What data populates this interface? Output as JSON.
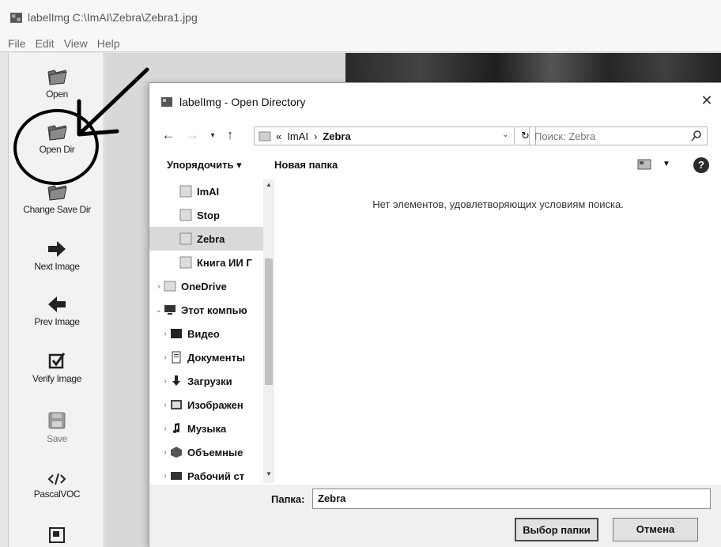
{
  "app": {
    "title": "labelImg C:\\ImAI\\Zebra\\Zebra1.jpg",
    "menu": [
      "File",
      "Edit",
      "View",
      "Help"
    ]
  },
  "toolbar": {
    "items": [
      {
        "label": "Open",
        "icon": "folder-icon"
      },
      {
        "label": "Open Dir",
        "icon": "folder-icon"
      },
      {
        "label": "Change Save Dir",
        "icon": "folder-icon"
      },
      {
        "label": "Next Image",
        "icon": "arrow-right-icon"
      },
      {
        "label": "Prev Image",
        "icon": "arrow-left-icon"
      },
      {
        "label": "Verify Image",
        "icon": "checkbox-icon"
      },
      {
        "label": "Save",
        "icon": "save-icon"
      },
      {
        "label": "PascalVOC",
        "icon": "code-icon"
      }
    ]
  },
  "dialog": {
    "title": "labelImg - Open Directory",
    "address": {
      "prefix": "«",
      "crumbs": [
        "ImAI",
        "Zebra"
      ]
    },
    "search_placeholder": "Поиск: Zebra",
    "organize_label": "Упорядочить ▾",
    "new_folder_label": "Новая папка",
    "tree": [
      {
        "label": "ImAI",
        "chevron": "",
        "icon": "folder-icon",
        "selected": false
      },
      {
        "label": "Stop",
        "chevron": "",
        "icon": "folder-icon",
        "selected": false
      },
      {
        "label": "Zebra",
        "chevron": "",
        "icon": "folder-icon",
        "selected": true
      },
      {
        "label": "Книга ИИ Г",
        "chevron": "",
        "icon": "folder-icon",
        "selected": false
      },
      {
        "label": "OneDrive",
        "chevron": "›",
        "icon": "cloud-folder-icon",
        "selected": false
      },
      {
        "label": "Этот компью",
        "chevron": "⌄",
        "icon": "computer-icon",
        "selected": false
      },
      {
        "label": "Видео",
        "chevron": "›",
        "icon": "video-icon",
        "selected": false
      },
      {
        "label": "Документы",
        "chevron": "›",
        "icon": "documents-icon",
        "selected": false
      },
      {
        "label": "Загрузки",
        "chevron": "›",
        "icon": "download-icon",
        "selected": false
      },
      {
        "label": "Изображен",
        "chevron": "›",
        "icon": "pictures-icon",
        "selected": false
      },
      {
        "label": "Музыка",
        "chevron": "›",
        "icon": "music-icon",
        "selected": false
      },
      {
        "label": "Объемные",
        "chevron": "›",
        "icon": "3d-objects-icon",
        "selected": false
      },
      {
        "label": "Рабочий ст",
        "chevron": "›",
        "icon": "desktop-icon",
        "selected": false
      }
    ],
    "empty_message": "Нет элементов, удовлетворяющих условиям поиска.",
    "folder_label": "Папка:",
    "folder_value": "Zebra",
    "select_button": "Выбор папки",
    "cancel_button": "Отмена",
    "close_glyph": "✕"
  },
  "colors": {
    "selection": "#d9d9d9",
    "annotation": "#000000"
  }
}
